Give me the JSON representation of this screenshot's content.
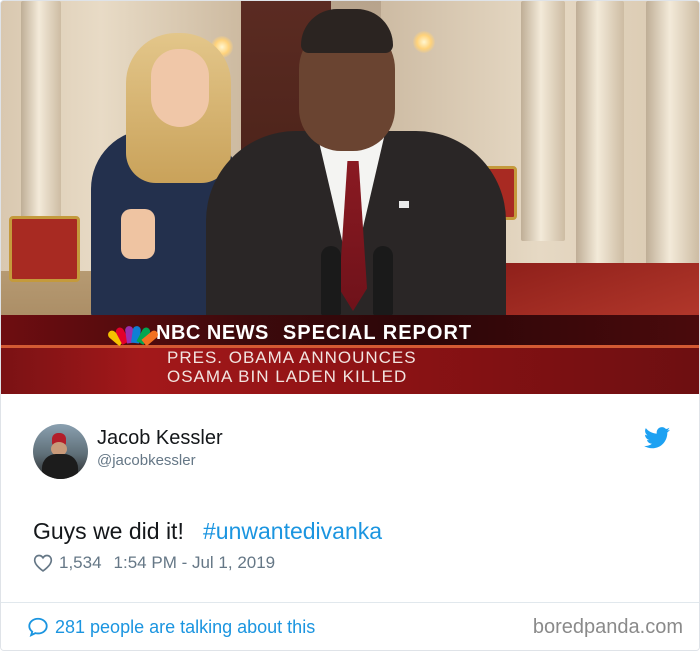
{
  "photo": {
    "broadcast": {
      "network": "NBC NEWS",
      "label": "SPECIAL REPORT",
      "headline_line1": "PRES. OBAMA ANNOUNCES",
      "headline_line2": "OSAMA BIN LADEN KILLED"
    },
    "peacock_colors": [
      "#f5c200",
      "#e4002b",
      "#9b2fae",
      "#0f7fd4",
      "#00a651",
      "#f37021"
    ]
  },
  "tweet": {
    "author": {
      "display_name": "Jacob Kessler",
      "handle": "@jacobkessler"
    },
    "text": "Guys we did it!",
    "hashtag": "#unwantedivanka",
    "likes": "1,534",
    "timestamp": "1:54 PM - Jul 1, 2019",
    "talking": "281 people are talking about this",
    "icons": {
      "platform": "twitter-bird-icon",
      "like": "heart-icon",
      "reply": "speech-bubble-icon"
    }
  },
  "source": "boredpanda.com",
  "colors": {
    "link": "#1b95e0",
    "muted": "#657786",
    "text": "#14171a"
  }
}
